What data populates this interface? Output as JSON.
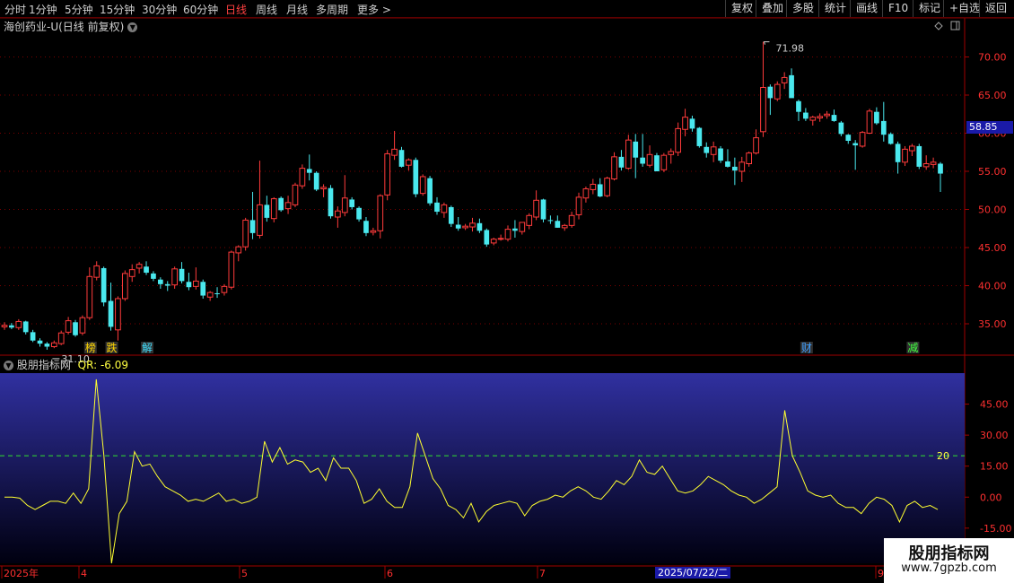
{
  "toolbar": {
    "periods": [
      "分时",
      "1分钟",
      "5分钟",
      "15分钟",
      "30分钟",
      "60分钟",
      "日线",
      "周线",
      "月线",
      "多周期",
      "更多"
    ],
    "active_period": "日线",
    "more_arrow": ">",
    "actions": [
      "复权",
      "叠加",
      "多股",
      "统计",
      "画线",
      "F10",
      "标记",
      "+自选",
      "返回"
    ]
  },
  "main_chart": {
    "title": "海创药业-U(日线 前复权)",
    "current_price": "58.85",
    "high_label": "71.98",
    "low_label": "31.10",
    "y_ticks": [
      "70.00",
      "65.00",
      "60.00",
      "55.00",
      "50.00",
      "45.00",
      "40.00",
      "35.00"
    ],
    "markers": [
      {
        "text": "榜",
        "color": "#ffd700"
      },
      {
        "text": "跌",
        "color": "#ffd700"
      },
      {
        "text": "解",
        "color": "#40e0ff"
      },
      {
        "text": "财",
        "color": "#40a0ff"
      },
      {
        "text": "减",
        "color": "#40ff40"
      }
    ]
  },
  "indicator": {
    "name": "股朋指标网",
    "qr_label": "QR: -6.09",
    "y_ticks": [
      "45.00",
      "30.00",
      "15.00",
      "0.00",
      "-15.00"
    ],
    "reference_label": "20"
  },
  "x_axis": {
    "labels": [
      "2025年",
      "4",
      "5",
      "6",
      "7",
      "9"
    ],
    "cursor_date": "2025/07/22/二"
  },
  "watermark": {
    "line1": "股朋指标网",
    "line2": "www.7gpzb.com"
  },
  "chart_data": {
    "type": "candlestick",
    "candles": [
      [
        34.6,
        35.2,
        34.2,
        34.8
      ],
      [
        34.8,
        35.1,
        34.3,
        34.5
      ],
      [
        34.5,
        35.6,
        34.2,
        35.3
      ],
      [
        35.3,
        35.4,
        33.6,
        33.9
      ],
      [
        33.9,
        34.2,
        32.6,
        32.8
      ],
      [
        32.8,
        33.1,
        32.0,
        32.4
      ],
      [
        32.4,
        32.6,
        31.6,
        32.0
      ],
      [
        32.0,
        32.8,
        31.8,
        32.5
      ],
      [
        32.4,
        34.1,
        32.2,
        33.8
      ],
      [
        33.9,
        35.9,
        33.6,
        35.4
      ],
      [
        35.2,
        35.5,
        33.3,
        33.5
      ],
      [
        33.8,
        36.1,
        33.5,
        35.8
      ],
      [
        35.8,
        42.4,
        35.5,
        41.2
      ],
      [
        41.1,
        43.2,
        40.7,
        42.6
      ],
      [
        42.3,
        42.5,
        37.3,
        37.8
      ],
      [
        38.0,
        40.4,
        34.1,
        34.6
      ],
      [
        34.2,
        38.6,
        32.8,
        38.3
      ],
      [
        38.3,
        42.0,
        38.0,
        41.6
      ],
      [
        41.2,
        42.8,
        40.5,
        42.1
      ],
      [
        42.3,
        43.1,
        41.6,
        42.8
      ],
      [
        42.5,
        43.2,
        41.4,
        41.7
      ],
      [
        41.6,
        41.9,
        40.6,
        40.9
      ],
      [
        40.8,
        41.1,
        39.6,
        40.2
      ],
      [
        40.2,
        40.6,
        39.3,
        40.0
      ],
      [
        40.1,
        42.5,
        39.6,
        42.2
      ],
      [
        42.2,
        43.1,
        40.3,
        40.6
      ],
      [
        40.5,
        41.7,
        39.4,
        39.8
      ],
      [
        39.9,
        42.4,
        39.5,
        40.6
      ],
      [
        40.5,
        40.8,
        38.3,
        38.7
      ],
      [
        38.5,
        39.3,
        38.0,
        39.1
      ],
      [
        39.0,
        39.8,
        38.4,
        38.9
      ],
      [
        39.1,
        40.2,
        38.7,
        39.9
      ],
      [
        39.8,
        44.6,
        39.5,
        44.4
      ],
      [
        44.3,
        45.3,
        43.2,
        45.1
      ],
      [
        45.1,
        48.9,
        44.6,
        48.6
      ],
      [
        48.6,
        52.3,
        46.1,
        46.9
      ],
      [
        46.6,
        56.4,
        46.2,
        50.6
      ],
      [
        50.6,
        51.8,
        48.4,
        48.9
      ],
      [
        48.8,
        51.6,
        48.3,
        51.4
      ],
      [
        51.5,
        51.7,
        49.7,
        49.9
      ],
      [
        50.1,
        51.8,
        49.4,
        50.9
      ],
      [
        50.6,
        53.5,
        50.3,
        53.2
      ],
      [
        53.1,
        55.9,
        52.7,
        55.4
      ],
      [
        55.3,
        57.2,
        53.8,
        54.8
      ],
      [
        54.8,
        55.0,
        52.4,
        52.6
      ],
      [
        52.7,
        53.3,
        51.6,
        52.9
      ],
      [
        52.8,
        53.2,
        48.8,
        49.1
      ],
      [
        49.0,
        50.4,
        47.6,
        49.8
      ],
      [
        49.6,
        54.5,
        49.1,
        51.5
      ],
      [
        51.3,
        51.6,
        50.0,
        50.3
      ],
      [
        50.2,
        50.4,
        48.4,
        48.7
      ],
      [
        48.5,
        49.0,
        46.5,
        46.9
      ],
      [
        47.0,
        47.6,
        46.6,
        47.2
      ],
      [
        47.2,
        52.0,
        46.2,
        51.8
      ],
      [
        51.9,
        57.8,
        51.2,
        57.3
      ],
      [
        57.1,
        60.3,
        56.5,
        57.9
      ],
      [
        57.8,
        58.2,
        55.5,
        55.6
      ],
      [
        55.8,
        56.7,
        55.1,
        56.5
      ],
      [
        56.5,
        56.8,
        51.6,
        52.0
      ],
      [
        52.1,
        54.6,
        51.8,
        54.3
      ],
      [
        54.1,
        54.4,
        50.5,
        50.8
      ],
      [
        50.9,
        51.6,
        49.3,
        49.7
      ],
      [
        49.6,
        50.9,
        48.9,
        50.6
      ],
      [
        50.3,
        50.5,
        47.7,
        48.1
      ],
      [
        48.0,
        49.0,
        47.2,
        47.5
      ],
      [
        47.6,
        48.1,
        47.3,
        47.8
      ],
      [
        47.7,
        48.9,
        47.1,
        48.2
      ],
      [
        48.2,
        48.8,
        46.9,
        47.2
      ],
      [
        47.3,
        47.5,
        45.1,
        45.4
      ],
      [
        45.6,
        46.3,
        45.3,
        46.1
      ],
      [
        46.2,
        46.7,
        45.9,
        46.2
      ],
      [
        46.1,
        47.9,
        45.8,
        47.4
      ],
      [
        47.5,
        48.6,
        46.3,
        47.2
      ],
      [
        47.1,
        48.2,
        46.7,
        48.3
      ],
      [
        47.9,
        49.5,
        47.4,
        49.2
      ],
      [
        49.0,
        52.5,
        48.6,
        51.2
      ],
      [
        51.3,
        51.4,
        48.3,
        48.7
      ],
      [
        48.6,
        49.2,
        48.1,
        48.5
      ],
      [
        48.5,
        49.2,
        47.6,
        47.6
      ],
      [
        47.6,
        48.1,
        47.2,
        47.9
      ],
      [
        47.9,
        49.7,
        47.6,
        49.2
      ],
      [
        49.3,
        52.2,
        48.7,
        51.6
      ],
      [
        51.5,
        53.0,
        50.9,
        52.7
      ],
      [
        52.6,
        54.0,
        52.0,
        53.3
      ],
      [
        53.3,
        54.1,
        51.6,
        51.7
      ],
      [
        51.8,
        54.3,
        51.6,
        54.1
      ],
      [
        54.0,
        57.5,
        53.8,
        56.9
      ],
      [
        56.9,
        57.8,
        55.1,
        55.5
      ],
      [
        55.4,
        59.8,
        55.2,
        59.1
      ],
      [
        58.9,
        59.9,
        54.1,
        56.8
      ],
      [
        56.8,
        59.9,
        55.6,
        56.0
      ],
      [
        55.8,
        58.4,
        55.5,
        57.2
      ],
      [
        57.1,
        57.4,
        55.0,
        55.0
      ],
      [
        55.2,
        57.4,
        54.9,
        57.1
      ],
      [
        57.2,
        58.0,
        56.0,
        57.6
      ],
      [
        57.5,
        61.4,
        57.0,
        60.6
      ],
      [
        60.5,
        63.2,
        59.6,
        62.1
      ],
      [
        61.9,
        62.3,
        60.2,
        60.6
      ],
      [
        60.7,
        60.8,
        58.1,
        58.3
      ],
      [
        58.2,
        58.8,
        56.8,
        57.4
      ],
      [
        57.2,
        58.9,
        56.2,
        58.2
      ],
      [
        58.0,
        58.3,
        56.1,
        56.4
      ],
      [
        56.3,
        57.9,
        55.5,
        55.6
      ],
      [
        55.6,
        56.8,
        53.2,
        55.1
      ],
      [
        55.0,
        56.9,
        53.6,
        56.2
      ],
      [
        56.0,
        57.6,
        55.6,
        57.4
      ],
      [
        57.4,
        60.5,
        57.2,
        59.4
      ],
      [
        60.2,
        71.98,
        59.5,
        66.0
      ],
      [
        66.1,
        66.4,
        62.4,
        64.6
      ],
      [
        64.5,
        66.8,
        64.2,
        66.4
      ],
      [
        66.6,
        68.0,
        65.8,
        67.3
      ],
      [
        67.6,
        68.5,
        65.1,
        64.6
      ],
      [
        64.2,
        64.4,
        61.6,
        62.8
      ],
      [
        62.7,
        63.3,
        61.6,
        61.9
      ],
      [
        61.7,
        62.3,
        61.0,
        62.1
      ],
      [
        62.0,
        62.6,
        61.5,
        62.2
      ],
      [
        62.3,
        62.9,
        61.9,
        62.5
      ],
      [
        62.4,
        63.1,
        61.5,
        61.6
      ],
      [
        61.4,
        61.6,
        59.6,
        59.9
      ],
      [
        59.8,
        59.9,
        58.6,
        59.0
      ],
      [
        58.7,
        59.1,
        55.2,
        58.4
      ],
      [
        58.3,
        60.3,
        58.1,
        60.1
      ],
      [
        60.0,
        63.2,
        59.9,
        62.9
      ],
      [
        62.8,
        63.4,
        61.1,
        61.3
      ],
      [
        61.6,
        64.1,
        58.9,
        59.8
      ],
      [
        59.9,
        60.1,
        58.5,
        58.6
      ],
      [
        58.6,
        58.9,
        54.7,
        56.2
      ],
      [
        56.2,
        58.3,
        55.7,
        57.9
      ],
      [
        57.7,
        58.6,
        57.0,
        58.3
      ],
      [
        58.3,
        58.6,
        55.3,
        55.6
      ],
      [
        55.6,
        57.1,
        55.2,
        56.0
      ],
      [
        55.9,
        56.8,
        55.4,
        56.2
      ],
      [
        56.0,
        56.2,
        52.3,
        54.7
      ]
    ],
    "y_range": [
      31.0,
      73.0
    ],
    "indicator": {
      "name": "股朋指标网",
      "reference_line": 20,
      "y_range": [
        -32,
        60
      ],
      "values": [
        0.0,
        0.0,
        -0.5,
        -4,
        -6,
        -4,
        -2,
        -2,
        -3,
        2,
        -3,
        4,
        57,
        20,
        -32,
        -8,
        -2,
        22,
        15,
        16,
        10,
        5,
        3,
        1,
        -2,
        -1,
        -2,
        0,
        2,
        -2,
        -1,
        -3,
        -2,
        0,
        27,
        17,
        24,
        16,
        18,
        17,
        12,
        14,
        8,
        19,
        14,
        14,
        8,
        -3,
        -1,
        4,
        -2,
        -5,
        -5,
        5,
        31,
        20,
        9,
        4,
        -4,
        -6,
        -10,
        -3,
        -12,
        -7,
        -4,
        -3,
        -2,
        -3,
        -9,
        -4,
        -2,
        -1,
        1,
        0,
        3,
        5,
        3,
        0,
        -1,
        3,
        8,
        6,
        10,
        18,
        12,
        11,
        15,
        9,
        3,
        2,
        3,
        6,
        10,
        8,
        6,
        3,
        1,
        0,
        -3,
        -1,
        2,
        5,
        42,
        20,
        12,
        3,
        1,
        0,
        1,
        -3,
        -5,
        -5,
        -8,
        -3,
        0,
        -1,
        -4,
        -12,
        -4,
        -2,
        -5,
        -4,
        -6
      ]
    }
  }
}
